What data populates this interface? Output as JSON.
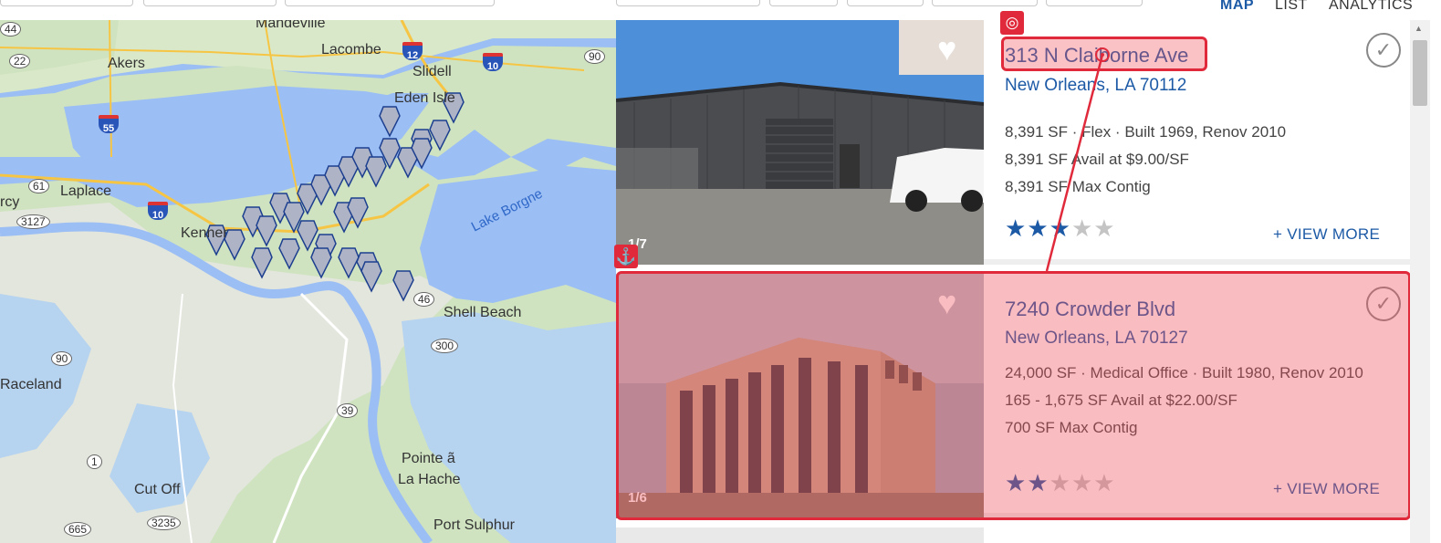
{
  "view_tabs": [
    {
      "label": "MAP",
      "active": true
    },
    {
      "label": "LIST",
      "active": false
    },
    {
      "label": "ANALYTICS",
      "active": false
    }
  ],
  "map": {
    "places": [
      "Mandeville",
      "Lacombe",
      "Slidell",
      "Eden Isle",
      "Akers",
      "Laplace",
      "Kenner",
      "Shell Beach",
      "Raceland",
      "Pointe ã",
      "La Hache",
      "Cut Off",
      "Port Sulphur",
      "rcy"
    ],
    "water_labels": [
      "Lake Borgne"
    ],
    "road_badges": [
      "44",
      "22",
      "61",
      "3127",
      "90",
      "1",
      "665",
      "3235",
      "39",
      "300",
      "46",
      "90"
    ],
    "interstates": [
      "12",
      "10",
      "55",
      "10"
    ]
  },
  "listings": [
    {
      "address": "313 N Claiborne Ave",
      "city": "New Orleans, LA 70112",
      "facts": [
        "8,391 SF · Flex · Built 1969, Renov 2010",
        "8,391 SF Avail at $9.00/SF",
        "8,391 SF Max Contig"
      ],
      "rating": 3,
      "photo_count": "1/7",
      "view_more": "+ VIEW MORE"
    },
    {
      "address": "7240 Crowder Blvd",
      "city": "New Orleans, LA 70127",
      "facts": [
        "24,000 SF · Medical Office · Built 1980, Renov 2010",
        "165 - 1,675 SF Avail at $22.00/SF",
        "700 SF Max Contig"
      ],
      "rating": 2,
      "photo_count": "1/6",
      "view_more": "+ VIEW MORE"
    }
  ],
  "icons": {
    "favorite": "heart-icon",
    "select": "checkmark-circle-icon",
    "star": "star-icon",
    "target": "target-icon",
    "anchor": "anchor-icon"
  },
  "colors": {
    "brand_blue": "#1d5aa6",
    "highlight_red": "#e02a3c",
    "water": "#9bbef5",
    "land": "#cfe3c0"
  }
}
